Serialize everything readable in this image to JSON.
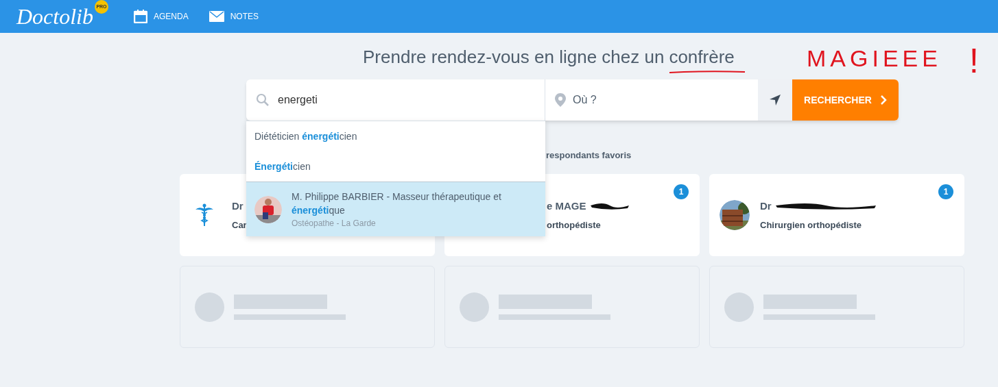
{
  "header": {
    "logo": "Doctolib",
    "logo_badge": "PRO",
    "nav": [
      {
        "kind": "calendar",
        "label": "AGENDA"
      },
      {
        "kind": "mail",
        "label": "NOTES"
      }
    ]
  },
  "title": {
    "text": "Prendre rendez-vous en ligne chez un",
    "emphasis": "confrère",
    "underlined": true
  },
  "annotation": {
    "text": "MAGIEEE",
    "mark": "!"
  },
  "search": {
    "value": "energeti",
    "location_placeholder": "Où ?",
    "button": "RECHERCHER"
  },
  "suggestions": [
    {
      "kind": "term",
      "text": "Diététicien **énergéti**cien",
      "selected": false
    },
    {
      "kind": "term",
      "text": "**Énergéti**cien",
      "selected": false
    },
    {
      "kind": "practitioner",
      "text": "M. Philippe BARBIER - Masseur thérapeutique et **énergéti**que",
      "subtitle": "Ostéopathe - La Garde",
      "selected": true
    }
  ],
  "favorites_heading": "respondants favoris",
  "cards": [
    {
      "kind": "caduceus",
      "name": "Dr",
      "specialty": "Car"
    },
    {
      "kind": "hidden",
      "name": "e MAGE",
      "specialty": "orthopédiste",
      "badge": "1",
      "redacted": true
    },
    {
      "name": "Dr",
      "specialty": "Chirurgien orthopédiste",
      "badge": "1",
      "redacted": true
    },
    {
      "kind": "skeleton"
    },
    {
      "kind": "skeleton"
    },
    {
      "kind": "skeleton"
    }
  ]
}
